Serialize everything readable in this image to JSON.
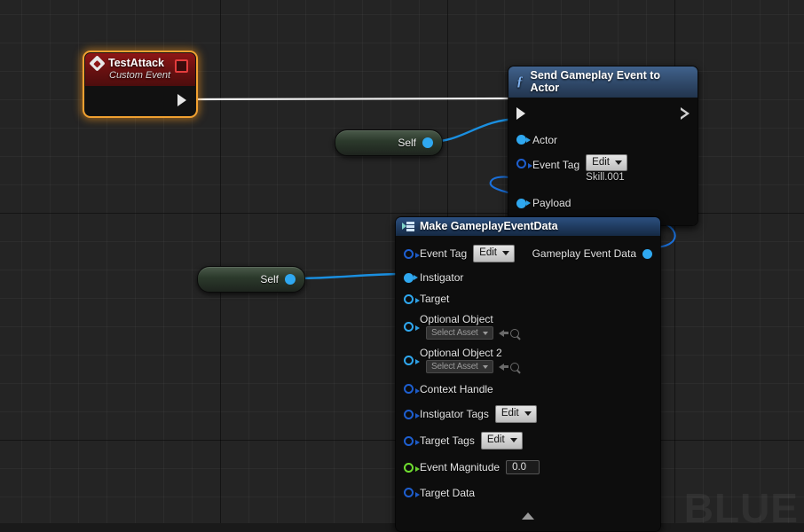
{
  "graph": {
    "background_color": "#242424",
    "grid_color": "#2f2f2f",
    "watermark": "BLUE"
  },
  "nodes": {
    "event": {
      "title": "TestAttack",
      "subtitle": "Custom Event",
      "icon": "event-diamond-icon",
      "accent": "#f0a030",
      "header_color": "#8e1616",
      "delegate_pin": "delegate-output-pin"
    },
    "send_event": {
      "title": "Send Gameplay Event to Actor",
      "icon": "function-f-icon",
      "header_color": "#2f4868",
      "pins": [
        {
          "name": "Actor",
          "type": "object",
          "color": "#2fa8f0"
        },
        {
          "name": "Event Tag",
          "type": "struct",
          "color": "#1e5fd0",
          "widget": "Edit",
          "value": "Skill.001"
        },
        {
          "name": "Payload",
          "type": "object",
          "color": "#2fa8f0"
        }
      ]
    },
    "make_event_data": {
      "title": "Make GameplayEventData",
      "icon": "make-struct-icon",
      "header_color": "#1f3a5e",
      "output": {
        "name": "Gameplay Event Data",
        "color": "#2fa8f0"
      },
      "pins": [
        {
          "name": "Event Tag",
          "type": "struct",
          "color": "#1e5fd0",
          "widget": "Edit"
        },
        {
          "name": "Instigator",
          "type": "object",
          "color": "#2fa8f0"
        },
        {
          "name": "Target",
          "type": "object",
          "color": "#2fa8f0"
        },
        {
          "name": "Optional Object",
          "type": "object",
          "color": "#2fa8f0",
          "asset_widget": "Select Asset"
        },
        {
          "name": "Optional Object 2",
          "type": "object",
          "color": "#2fa8f0",
          "asset_widget": "Select Asset"
        },
        {
          "name": "Context Handle",
          "type": "struct",
          "color": "#1e5fd0"
        },
        {
          "name": "Instigator Tags",
          "type": "struct",
          "color": "#1e5fd0",
          "widget": "Edit"
        },
        {
          "name": "Target Tags",
          "type": "struct",
          "color": "#1e5fd0",
          "widget": "Edit"
        },
        {
          "name": "Event Magnitude",
          "type": "real",
          "color": "#6fdd30",
          "value": "0.0"
        },
        {
          "name": "Target Data",
          "type": "struct",
          "color": "#1e5fd0"
        }
      ]
    },
    "self_top": {
      "label": "Self"
    },
    "self_bottom": {
      "label": "Self"
    }
  }
}
